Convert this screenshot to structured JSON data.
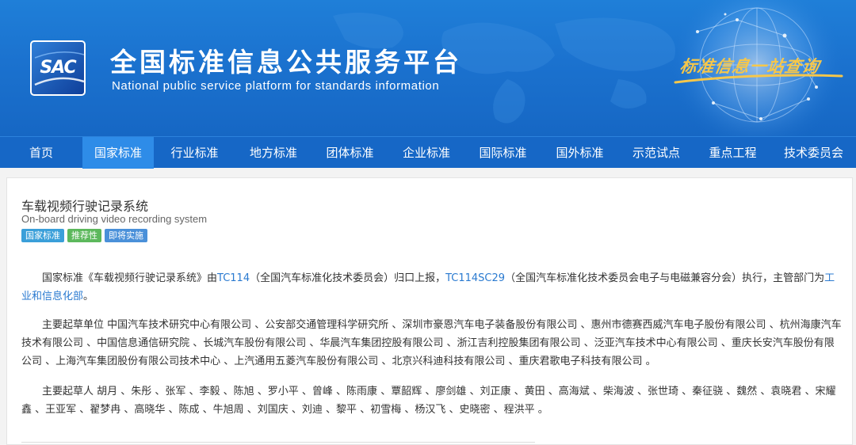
{
  "header": {
    "logo_text": "SAC",
    "title_cn": "全国标准信息公共服务平台",
    "title_en": "National public service platform  for standards information",
    "slogan": "标准信息一站查询"
  },
  "nav": {
    "items": [
      "首页",
      "国家标准",
      "行业标准",
      "地方标准",
      "团体标准",
      "企业标准",
      "国际标准",
      "国外标准",
      "示范试点",
      "重点工程",
      "技术委员会"
    ],
    "active_index": 1
  },
  "standard": {
    "title_cn": "车载视频行驶记录系统",
    "title_en": "On-board driving video recording system",
    "tags": [
      "国家标准",
      "推荐性",
      "即将实施"
    ],
    "p1": {
      "t1": "国家标准《车载视频行驶记录系统》由",
      "link1": "TC114",
      "t2": "（全国汽车标准化技术委员会）归口上报，",
      "link2": "TC114SC29",
      "t3": "（全国汽车标准化技术委员会电子与电磁兼容分会）执行，主管部门为",
      "link3": "工业和信息化部",
      "t4": "。"
    },
    "p2": "主要起草单位 中国汽车技术研究中心有限公司 、公安部交通管理科学研究所 、深圳市豪恩汽车电子装备股份有限公司 、惠州市德赛西威汽车电子股份有限公司 、杭州海康汽车技术有限公司 、中国信息通信研究院 、长城汽车股份有限公司 、华晨汽车集团控股有限公司 、浙江吉利控股集团有限公司 、泛亚汽车技术中心有限公司 、重庆长安汽车股份有限公司 、上海汽车集团股份有限公司技术中心 、上汽通用五菱汽车股份有限公司 、北京兴科迪科技有限公司 、重庆君歌电子科技有限公司 。",
    "p3": "主要起草人 胡月 、朱彤 、张军 、李毅 、陈旭 、罗小平 、曾峰 、陈雨康 、覃韶辉 、廖剑雄 、刘正康 、黄田 、高海斌 、柴海波 、张世琦 、秦征骁 、魏然 、袁晓君 、宋耀鑫 、王亚军 、翟梦冉 、高晓华 、陈成 、牛旭周 、刘国庆 、刘迪 、黎平 、初雪梅 、杨汉飞 、史晓密 、程洪平 。"
  },
  "colors": {
    "banner_blue": "#1b72cf",
    "nav_blue": "#1667c6",
    "nav_active": "#2e8ce8",
    "link": "#2a7ad0",
    "slogan_gold": "#f6c74a",
    "tag_national": "#3a9fd9",
    "tag_recommended": "#5cb85c",
    "tag_upcoming": "#4a90d9"
  }
}
